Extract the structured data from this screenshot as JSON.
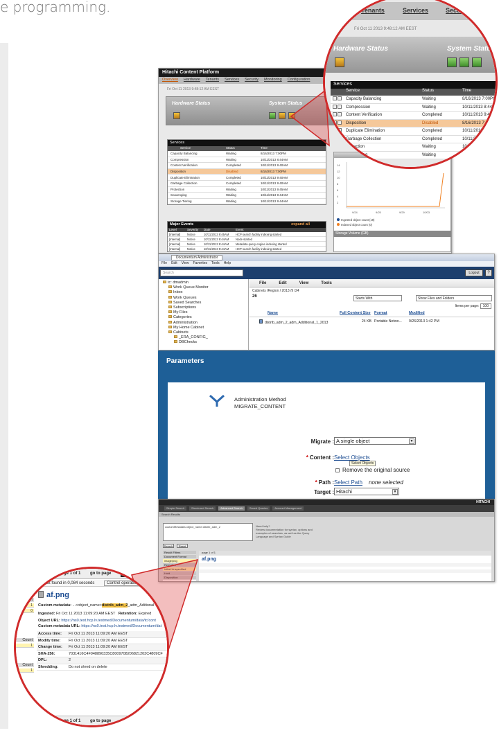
{
  "intro_text": "e programming.",
  "hcp": {
    "app_title": "Hitachi Content Platform",
    "nav": [
      "Overview",
      "Hardware",
      "Tenants",
      "Services",
      "Security",
      "Monitoring",
      "Configuration"
    ],
    "date": "Fri Oct 11 2013 9:48:12 AM EEST",
    "hardware_status": "Hardware Status",
    "system_status": "System Status",
    "services_header": "Services",
    "services_cols": [
      "Service",
      "Status",
      "Time"
    ],
    "services": [
      {
        "name": "Capacity Balancing",
        "status": "Waiting",
        "time": "8/16/2013 7:00PM"
      },
      {
        "name": "Compression",
        "status": "Waiting",
        "time": "10/11/2013 8:44AM"
      },
      {
        "name": "Content Verification",
        "status": "Completed",
        "time": "10/11/2013 9:40AM"
      },
      {
        "name": "Disposition",
        "status": "Disabled",
        "time": "8/16/2013 7:00PM"
      },
      {
        "name": "Duplicate Elimination",
        "status": "Completed",
        "time": "10/11/2013 9:40AM"
      },
      {
        "name": "Garbage Collection",
        "status": "Completed",
        "time": "10/11/2013 9:40AM"
      },
      {
        "name": "Protection",
        "status": "Waiting",
        "time": "10/11/2013 9:45AM"
      },
      {
        "name": "Scavenging",
        "status": "Waiting",
        "time": "10/11/2013 9:44AM"
      },
      {
        "name": "Storage Tiering",
        "status": "Waiting",
        "time": "10/11/2013 9:44AM"
      }
    ],
    "events_header": "Major Events",
    "events_expand": "expand all",
    "events_cols": [
      "Level",
      "Severity",
      "Date",
      "Event"
    ],
    "events": [
      {
        "level": "[Internal]",
        "severity": "Notice",
        "date": "10/11/2013 9:45AM",
        "event": "HCP search facility indexing started"
      },
      {
        "level": "[Internal]",
        "severity": "Notice",
        "date": "10/11/2013 9:44AM",
        "event": "Node started"
      },
      {
        "level": "[Internal]",
        "severity": "Notice",
        "date": "10/11/2013 9:44AM",
        "event": "Metadata query engine indexing started"
      },
      {
        "level": "[Internal]",
        "severity": "Notice",
        "date": "10/11/2013 9:44AM",
        "event": "HCP search facility indexing started"
      }
    ],
    "chart_legend": [
      "Ingested object count (19)",
      "Indexed object count (0)"
    ],
    "chart_xticks": [
      "9/24",
      "9/25",
      "9/29",
      "10/03"
    ],
    "chart_yticks": [
      "14",
      "12",
      "10",
      "8",
      "6",
      "4",
      "2"
    ],
    "volume_header": "Storage Volume (GB)",
    "volume_yticks": [
      "1M",
      "2M"
    ],
    "colors": {
      "accent": "#c35400",
      "disabled_row": "#f5c89a",
      "header_black": "#111111"
    }
  },
  "documentum": {
    "tab_title": "Documentum Administrator",
    "menu": [
      "File",
      "Edit",
      "View",
      "Favorites",
      "Tools",
      "Help"
    ],
    "search_placeholder": "Search",
    "logout": "Logout",
    "help": "?",
    "tree": [
      "tc: dmadmin",
      "Work Queue Monitor",
      "Inbox",
      "Work Queues",
      "Saved Searches",
      "Subscriptions",
      "My Files",
      "Categories",
      "Administration",
      "My Home Cabinet",
      "Cabinets",
      "_ERA_CONFIG_",
      "DBChecks"
    ],
    "main_menu": [
      "File",
      "Edit",
      "View",
      "Tools"
    ],
    "path": "Cabinets /Region / 2013 /9 /24",
    "count": "26",
    "filter_mode": "Starts With",
    "show_mode": "Show Files and Folders",
    "items_per_page_label": "Items per page:",
    "items_per_page": "100",
    "columns": [
      "Name",
      "Full Content Size",
      "Format",
      "Modified"
    ],
    "file": {
      "name": "distrib_adm_2_adm_Additional_1_2013",
      "size": "24 KB",
      "format": "Portable Netwo...",
      "modified": "9/26/2013 1:42 PM"
    }
  },
  "parameters": {
    "title": "Parameters",
    "method_label": "Administration Method",
    "method_name": "MIGRATE_CONTENT",
    "migrate_label": "Migrate :",
    "migrate_value": "A single object",
    "content_label": "Content :",
    "content_link": "Select Objects",
    "tooltip": "Select Objects",
    "remove_label": "Remove the original source",
    "path_label": "Path :",
    "path_link": "Select Path",
    "path_status": "none selected",
    "target_label": "Target :",
    "target_value": "Hitachi"
  },
  "search": {
    "brand": "HITACHI",
    "tabs": [
      "Simple Search",
      "Structured Search",
      "Advanced Search",
      "Saved Queries",
      "Account Management"
    ],
    "crumb": "Search Results",
    "query": "customMetadata object_name:distrib_adm_2",
    "info_lines": [
      "Need help?",
      "Review documentation for syntax, options and",
      "examples of searches, as well as the Query",
      "Language and Syntax Guide"
    ],
    "buttons": [
      "Search",
      "Reset"
    ],
    "left_rows": [
      "Result Filters",
      "Document Format",
      "image/png",
      "Retention",
      "Initial Unspecified",
      "Hold",
      "Disposition",
      "Metadata",
      "Ingested"
    ],
    "result_title": "af.png",
    "page_bar": "page 1 of 1"
  },
  "zoom_top": {
    "links": [
      "Tenants",
      "Services",
      "Security"
    ],
    "date": "Fri Oct 11 2013 9:48:12 AM EEST",
    "hardware_status": "Hardware Status",
    "system_status": "System Status",
    "services_header": "Services",
    "cols": [
      "Service",
      "Status",
      "Time"
    ],
    "rows": [
      {
        "name": "Capacity Balancing",
        "status": "Waiting",
        "time": "8/16/2013 7:00PM"
      },
      {
        "name": "Compression",
        "status": "Waiting",
        "time": "10/11/2013 8:44AM"
      },
      {
        "name": "Content Verification",
        "status": "Completed",
        "time": "10/11/2013 9:40AM"
      },
      {
        "name": "Disposition",
        "status": "Disabled",
        "time": "8/16/2013 7:00PM"
      },
      {
        "name": "Duplicate Elimination",
        "status": "Completed",
        "time": "10/11/2013 9:40AM"
      },
      {
        "name": "Garbage Collection",
        "status": "Completed",
        "time": "10/11/2013 9:40AM"
      },
      {
        "name": "Protection",
        "status": "Waiting",
        "time": "10/11/2013"
      },
      {
        "name": "Scavenging",
        "status": "Waiting",
        "time": "10/11/"
      }
    ]
  },
  "zoom_bottom": {
    "page_label": "page 1 of 1",
    "go_to_page": "go to page",
    "go": "go",
    "found": "1 result found in 0,084 seconds",
    "control_ops": "Control operations",
    "count_label": "Count",
    "counts": [
      "1",
      "0",
      "1",
      "1"
    ],
    "title": "af.png",
    "custom_metadata_label": "Custom metadata:",
    "custom_metadata_prefix": "...<object_name>",
    "custom_metadata_highlight": "distrib_adm_2",
    "custom_metadata_suffix": "_adm_Aditional",
    "ingested_label": "Ingested:",
    "ingested_value": "Fri Oct 11 2013 11:09:20 AM EEST",
    "retention_label": "Retention:",
    "retention_value": "Expired",
    "object_url_label": "Object URL:",
    "object_url": "https://ns0.test.hcp.lv.testmed/Documentum/data/tc/cont",
    "custom_url_label": "Custom metadata URL:",
    "custom_url": "https://ns0.test.hcp.lv.testmed/Documentum/dat",
    "details": [
      {
        "key": "Access time:",
        "value": "Fri Oct 11 2013 11:09:20 AM EEST"
      },
      {
        "key": "Modify time:",
        "value": "Fri Oct 11 2013 11:09:20 AM EEST"
      },
      {
        "key": "Change time:",
        "value": "Fri Oct 11 2013 11:09:20 AM EEST"
      },
      {
        "key": "SHA-256:",
        "value": "7031416C4F048890335C8009708206821203C4809CF"
      },
      {
        "key": "DPL:",
        "value": "2"
      },
      {
        "key": "Shredding:",
        "value": "Do not shred on delete"
      }
    ]
  }
}
